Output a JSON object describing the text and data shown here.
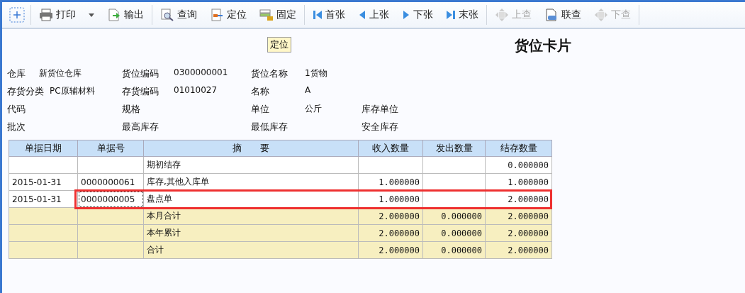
{
  "toolbar": [
    {
      "kind": "add",
      "separator_after": true
    },
    {
      "kind": "print",
      "label": "打印",
      "disabled": false,
      "dropdown": true,
      "separator_after": false
    },
    {
      "kind": "export",
      "label": "输出",
      "disabled": false,
      "separator_after": true
    },
    {
      "kind": "query",
      "label": "查询",
      "disabled": false,
      "separator_after": false
    },
    {
      "kind": "locate",
      "label": "定位",
      "disabled": false,
      "separator_after": false
    },
    {
      "kind": "pin",
      "label": "固定",
      "disabled": false,
      "separator_after": true
    },
    {
      "kind": "first",
      "label": "首张",
      "disabled": false,
      "separator_after": false
    },
    {
      "kind": "prev",
      "label": "上张",
      "disabled": false,
      "separator_after": false
    },
    {
      "kind": "next",
      "label": "下张",
      "disabled": false,
      "separator_after": false
    },
    {
      "kind": "last",
      "label": "末张",
      "disabled": false,
      "separator_after": true
    },
    {
      "kind": "up",
      "label": "上查",
      "disabled": true,
      "separator_after": false
    },
    {
      "kind": "link",
      "label": "联查",
      "disabled": false,
      "separator_after": false
    },
    {
      "kind": "down",
      "label": "下查",
      "disabled": true,
      "separator_after": true
    }
  ],
  "locate_tag": "定位",
  "title": "货位卡片",
  "fields": [
    [
      {
        "label": "仓库",
        "value": "新货位仓库"
      },
      {
        "label": "货位编码",
        "value": "0300000001"
      },
      {
        "label": "货位名称",
        "value": "1货物"
      }
    ],
    [
      {
        "label": "存货分类",
        "value": "PC原辅材料"
      },
      {
        "label": "存货编码",
        "value": "01010027"
      },
      {
        "label": "名称",
        "value": "A"
      }
    ],
    [
      {
        "label": "代码"
      },
      {
        "label": "规格"
      },
      {
        "label": "单位",
        "value": "公斤"
      },
      {
        "label": "库存单位"
      }
    ],
    [
      {
        "label": "批次"
      },
      {
        "label": "最高库存"
      },
      {
        "label": "最低库存"
      },
      {
        "label": "安全库存"
      }
    ]
  ],
  "table": {
    "columns": [
      "单据日期",
      "单据号",
      "摘　　要",
      "收入数量",
      "发出数量",
      "结存数量"
    ],
    "rows": [
      {
        "kind": "detail",
        "highlighted": false,
        "cells": [
          "",
          "",
          "期初结存",
          "",
          "",
          "0.000000"
        ]
      },
      {
        "kind": "detail",
        "highlighted": false,
        "cells": [
          "2015-01-31",
          "0000000061",
          "库存,其他入库单",
          "1.000000",
          "",
          "1.000000"
        ]
      },
      {
        "kind": "detail",
        "highlighted": true,
        "cells": [
          "2015-01-31",
          "0000000005",
          "盘点单",
          "1.000000",
          "",
          "2.000000"
        ]
      },
      {
        "kind": "total",
        "highlighted": false,
        "cells": [
          "",
          "",
          "本月合计",
          "2.000000",
          "0.000000",
          "2.000000"
        ]
      },
      {
        "kind": "total",
        "highlighted": false,
        "cells": [
          "",
          "",
          "本年累计",
          "2.000000",
          "0.000000",
          "2.000000"
        ]
      },
      {
        "kind": "total",
        "highlighted": false,
        "cells": [
          "",
          "",
          "合计",
          "2.000000",
          "0.000000",
          "2.000000"
        ]
      }
    ]
  }
}
